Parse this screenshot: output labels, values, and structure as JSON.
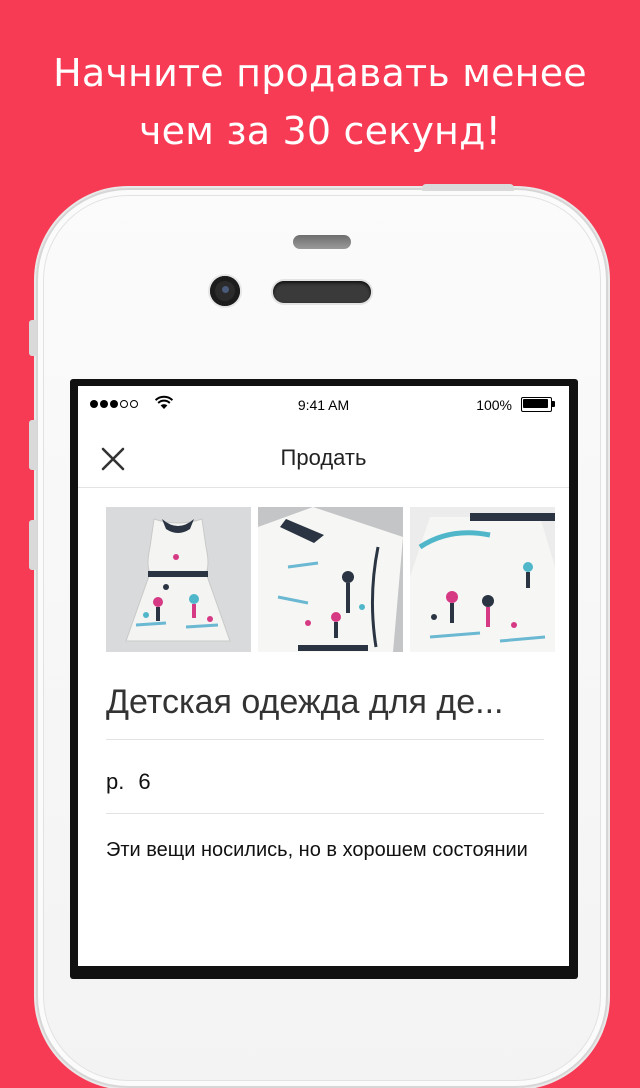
{
  "headline": {
    "line1": "Начните продавать менее",
    "line2": "чем за 30 секунд!"
  },
  "status_bar": {
    "time": "9:41 AM",
    "battery": "100%"
  },
  "nav": {
    "title": "Продать",
    "close_icon": "close-icon"
  },
  "listing": {
    "photos": [
      "dress-front-photo",
      "dress-detail-photo",
      "dress-side-photo"
    ],
    "title": "Детская одежда для де...",
    "size_label": "р.",
    "size_value": "6",
    "description": "Эти вещи носились, но в хорошем состоянии"
  },
  "colors": {
    "background": "#f73b55",
    "phone_body": "#f6f6f6",
    "text_primary": "#222222"
  }
}
